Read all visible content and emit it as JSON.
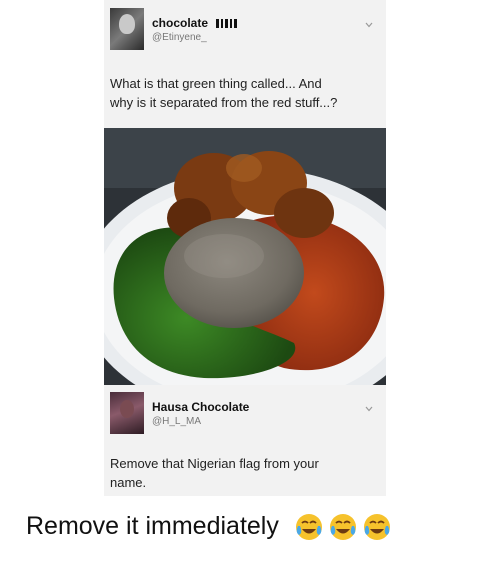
{
  "tweet1": {
    "display_name": "chocolate",
    "handle": "@Etinyene_",
    "text_line1": "What is that green thing called... And",
    "text_line2": "why is it separated from the red stuff...?"
  },
  "photo": {
    "icon": "food-photo",
    "plate_color": "#e9ecef",
    "background_color": "#2d3237",
    "amala_color": "#7c776d",
    "greens_color": "#2e6b1e",
    "stew_color": "#a8381a",
    "meat_color": "#7a3a12"
  },
  "tweet2": {
    "display_name": "Hausa Chocolate",
    "handle": "@H_L_MA",
    "text_line1": "Remove that Nigerian flag from your",
    "text_line2": "name."
  },
  "caption": {
    "text": "Remove it immediately",
    "emoji": [
      "face-with-tears-of-joy",
      "face-with-tears-of-joy",
      "face-with-tears-of-joy"
    ]
  }
}
